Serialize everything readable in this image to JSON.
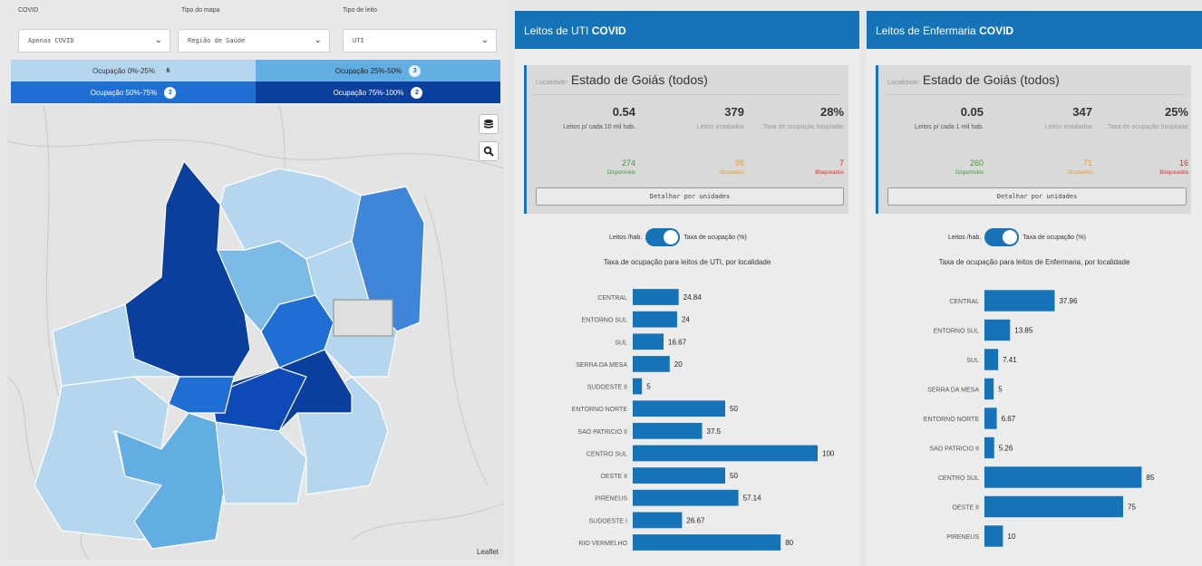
{
  "filters": {
    "covid": {
      "label": "COVID",
      "value": "Apenas COVID"
    },
    "map_type": {
      "label": "Tipo do mapa",
      "value": "Região de Saúde"
    },
    "bed_type": {
      "label": "Tipo de leito",
      "value": "UTI"
    }
  },
  "legend": [
    {
      "label": "Ocupação 0%-25%",
      "count": "6",
      "bg": "#b5d6ef",
      "fg": "#333333"
    },
    {
      "label": "Ocupação 25%-50%",
      "count": "3",
      "bg": "#62ade2",
      "fg": "#222222"
    },
    {
      "label": "Ocupação 50%-75%",
      "count": "3",
      "bg": "#1f6ed4",
      "fg": "#ffffff"
    },
    {
      "label": "Ocupação 75%-100%",
      "count": "2",
      "bg": "#0a3f9e",
      "fg": "#ffffff"
    }
  ],
  "map": {
    "layers_icon": "layers-icon",
    "search_icon": "search-icon",
    "attribution": "Leaflet"
  },
  "uti": {
    "title_prefix": "Leitos de UTI ",
    "title_bold": "COVID",
    "locality_label": "Localidade:",
    "locality": "Estado de Goiás (todos)",
    "stats": [
      {
        "value": "0.54",
        "label": "Leitos p/ cada 10 mil hab."
      },
      {
        "value": "379",
        "label": "Leitos instalados"
      },
      {
        "value": "28%",
        "label": "Taxa de ocupação hospitalar"
      }
    ],
    "sub": [
      {
        "value": "274",
        "label": "Disponíveis",
        "color": "#3a9a3a"
      },
      {
        "value": "98",
        "label": "Ocupados",
        "color": "#e79b2e"
      },
      {
        "value": "7",
        "label": "Bloqueados",
        "color": "#d42e2e"
      }
    ],
    "detail_button": "Detalhar por unidades",
    "toggle_left": "Leitos /hab.",
    "toggle_right": "Taxa de ocupação (%)",
    "chart_title": "Taxa de ocupação para leitos de UTI, por localidade"
  },
  "enf": {
    "title_prefix": "Leitos de Enfermaria ",
    "title_bold": "COVID",
    "locality_label": "Localidade:",
    "locality": "Estado de Goiás (todos)",
    "stats": [
      {
        "value": "0.05",
        "label": "Leitos p/ cada 1 mil hab."
      },
      {
        "value": "347",
        "label": "Leitos instalados"
      },
      {
        "value": "25%",
        "label": "Taxa de ocupação hospitalar"
      }
    ],
    "sub": [
      {
        "value": "260",
        "label": "Disponíveis",
        "color": "#3a9a3a"
      },
      {
        "value": "71",
        "label": "Ocupados",
        "color": "#e79b2e"
      },
      {
        "value": "16",
        "label": "Bloqueados",
        "color": "#d42e2e"
      }
    ],
    "detail_button": "Detalhar por unidades",
    "toggle_left": "Leitos /hab.",
    "toggle_right": "Taxa de ocupação (%)",
    "chart_title": "Taxa de ocupação para leitos de Enfermaria, por localidade"
  },
  "chart_data": [
    {
      "type": "bar",
      "orientation": "horizontal",
      "title": "Taxa de ocupação para leitos de UTI, por localidade",
      "categories": [
        "CENTRAL",
        "ENTORNO SUL",
        "SUL",
        "SERRA DA MESA",
        "SUDOESTE II",
        "ENTORNO NORTE",
        "SAO PATRICIO II",
        "CENTRO SUL",
        "OESTE II",
        "PIRENEUS",
        "SUDOESTE I",
        "RIO VERMELHO"
      ],
      "values": [
        24.84,
        24,
        16.67,
        20,
        5,
        50,
        37.5,
        100,
        50,
        57.14,
        26.67,
        80
      ],
      "labels": [
        "24.84",
        "24",
        "16.67",
        "20",
        "5",
        "50",
        "37.5",
        "100",
        "50",
        "57.14",
        "26.67",
        "80"
      ],
      "xlim": [
        0,
        100
      ],
      "color": "#1673b8"
    },
    {
      "type": "bar",
      "orientation": "horizontal",
      "title": "Taxa de ocupação para leitos de Enfermaria, por localidade",
      "categories": [
        "CENTRAL",
        "ENTORNO SUL",
        "SUL",
        "SERRA DA MESA",
        "ENTORNO NORTE",
        "SAO PATRICIO II",
        "CENTRO SUL",
        "OESTE II",
        "PIRENEUS"
      ],
      "values": [
        37.96,
        13.85,
        7.41,
        5,
        6.67,
        5.26,
        85,
        75,
        10
      ],
      "labels": [
        "37.96",
        "13.85",
        "7.41",
        "5",
        "6.67",
        "5.26",
        "85",
        "75",
        "10"
      ],
      "xlim": [
        0,
        100
      ],
      "color": "#1673b8"
    }
  ]
}
